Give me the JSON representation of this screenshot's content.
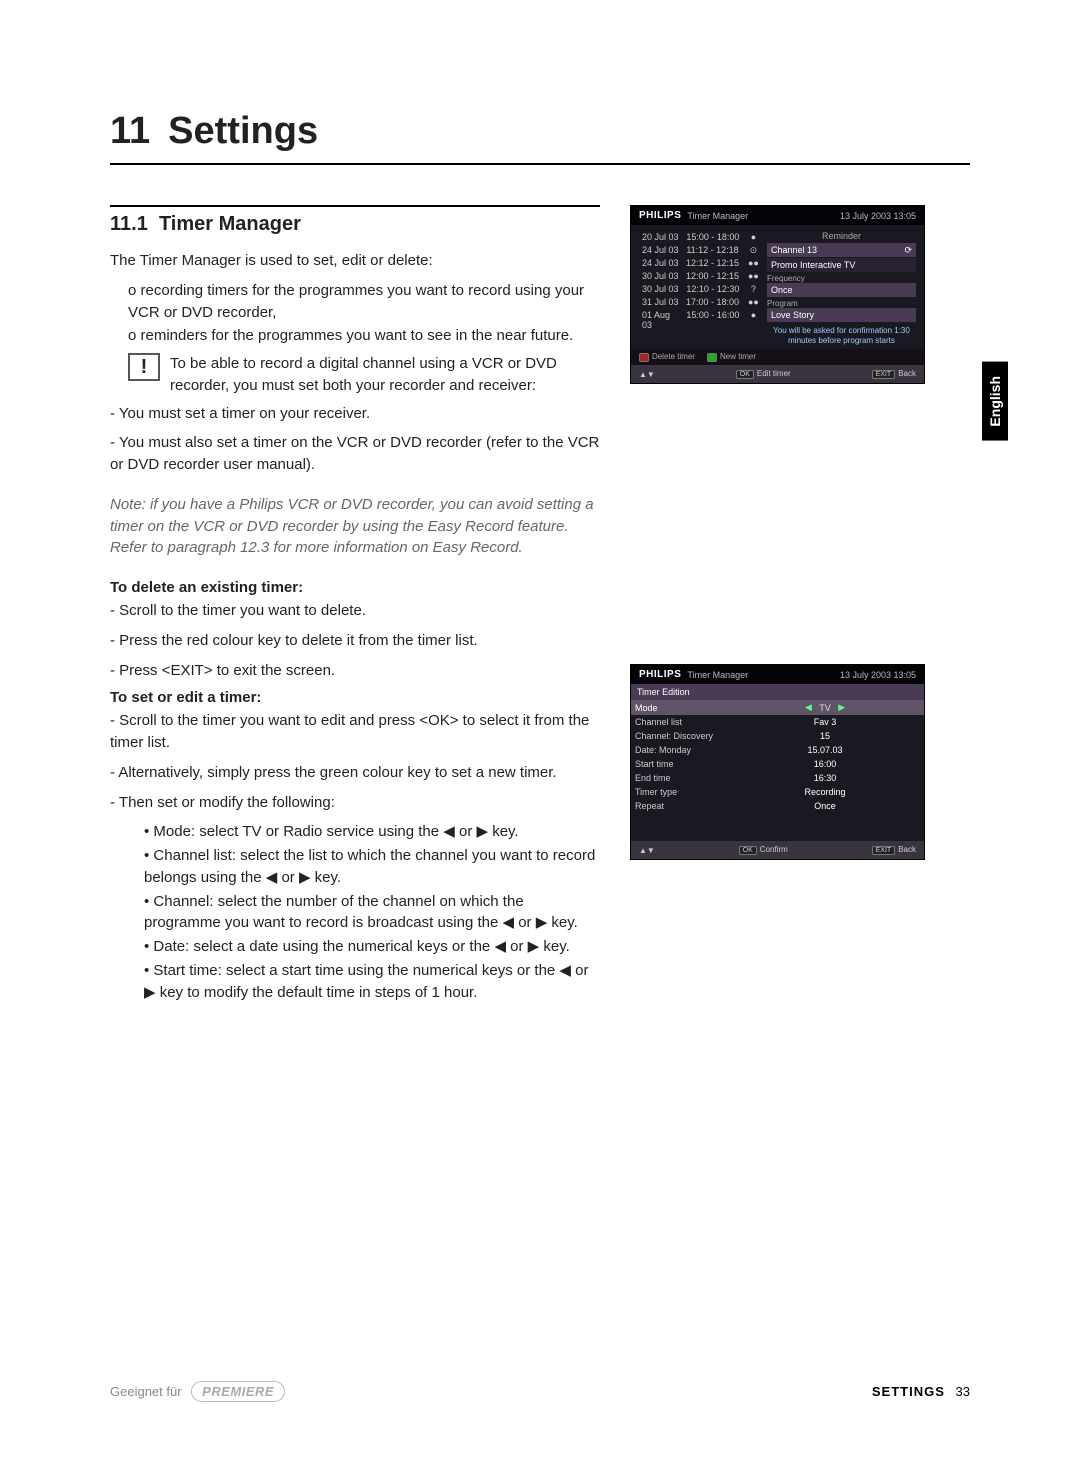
{
  "chapter": {
    "number": "11",
    "title": "Settings"
  },
  "section": {
    "number": "11.1",
    "title": "Timer Manager"
  },
  "side_tab": "English",
  "intro": "The Timer Manager is used to set, edit or delete:",
  "intro_items": [
    "recording timers for the programmes you want to record using your VCR or DVD recorder,",
    "reminders for the programmes you want to see in the near future."
  ],
  "warning": "To be able to record a digital channel using a VCR or DVD recorder, you must set both your recorder and receiver:",
  "warning_bullets": [
    "You must set a timer on your receiver.",
    "You must also set a timer on the VCR or DVD recorder (refer to the VCR or DVD recorder user manual)."
  ],
  "note": "Note: if you have a Philips VCR or DVD recorder, you can avoid setting a timer on the VCR or DVD recorder by using the Easy Record feature. Refer to paragraph 12.3 for more information on Easy Record.",
  "delete_heading": "To delete an existing timer:",
  "delete_steps": [
    "Scroll to the timer you want to delete.",
    "Press the red colour key to delete it from the timer list.",
    "Press <EXIT> to exit the screen."
  ],
  "set_heading": "To set or edit a timer:",
  "set_steps": [
    "Scroll to the timer you want to edit and press <OK> to select it from the timer list.",
    "Alternatively, simply press the green colour key to set a new timer.",
    "Then set or modify the following:"
  ],
  "set_subitems": [
    "Mode: select TV or Radio service using the ◀ or ▶  key.",
    "Channel list: select the list to which the channel you want to record belongs using the ◀ or ▶  key.",
    "Channel: select the number of the channel on which the programme you want to record is broadcast using the ◀ or ▶  key.",
    "Date: select a date using the numerical keys or the ◀ or ▶  key.",
    "Start time: select a start time using the numerical keys or the ◀ or ▶  key to modify the default time in steps of 1 hour."
  ],
  "tv1": {
    "brand": "PHILIPS",
    "title": "Timer Manager",
    "datetime": "13 July 2003   13:05",
    "timers": [
      {
        "date": "20 Jul 03",
        "time": "15:00 - 18:00",
        "dot": "●"
      },
      {
        "date": "24 Jul 03",
        "time": "11:12 - 12:18",
        "dot": "⊙"
      },
      {
        "date": "24 Jul 03",
        "time": "12:12 - 12:15",
        "dot": "●●"
      },
      {
        "date": "30 Jul 03",
        "time": "12:00 - 12:15",
        "dot": "●●"
      },
      {
        "date": "30 Jul 03",
        "time": "12:10 - 12:30",
        "dot": "?"
      },
      {
        "date": "31 Jul 03",
        "time": "17:00 - 18:00",
        "dot": "●●"
      },
      {
        "date": "01 Aug 03",
        "time": "15:00 - 16:00",
        "dot": "●"
      }
    ],
    "reminder_label": "Reminder",
    "fields": {
      "channel_label": "Channel 13",
      "channel_name": "Promo Interactive TV",
      "freq_label": "Frequency",
      "freq_value": "Once",
      "prog_label": "Program",
      "prog_value": "Love Story"
    },
    "confirm": "You will be asked for confirmation 1:30 minutes before program starts",
    "strip_delete": "Delete timer",
    "strip_new": "New timer",
    "foot_edit": "Edit timer",
    "foot_back": "Back",
    "nav": "▲▼"
  },
  "tv2": {
    "brand": "PHILIPS",
    "title": "Timer Manager",
    "datetime": "13 July 2003   13:05",
    "header": "Timer Edition",
    "rows": [
      {
        "label": "Mode",
        "value": "TV",
        "arrows": true
      },
      {
        "label": "Channel list",
        "value": "Fav 3"
      },
      {
        "label": "Channel: Discovery",
        "value": "15"
      },
      {
        "label": "Date: Monday",
        "value": "15.07.03"
      },
      {
        "label": "Start time",
        "value": "16:00"
      },
      {
        "label": "End time",
        "value": "16:30"
      },
      {
        "label": "Timer type",
        "value": "Recording"
      },
      {
        "label": "Repeat",
        "value": "Once"
      }
    ],
    "foot_confirm": "Confirm",
    "foot_back": "Back",
    "nav": "▲▼"
  },
  "footer": {
    "geeignet": "Geeignet für",
    "premiere": "PREMIERE",
    "section": "SETTINGS",
    "page": "33"
  }
}
